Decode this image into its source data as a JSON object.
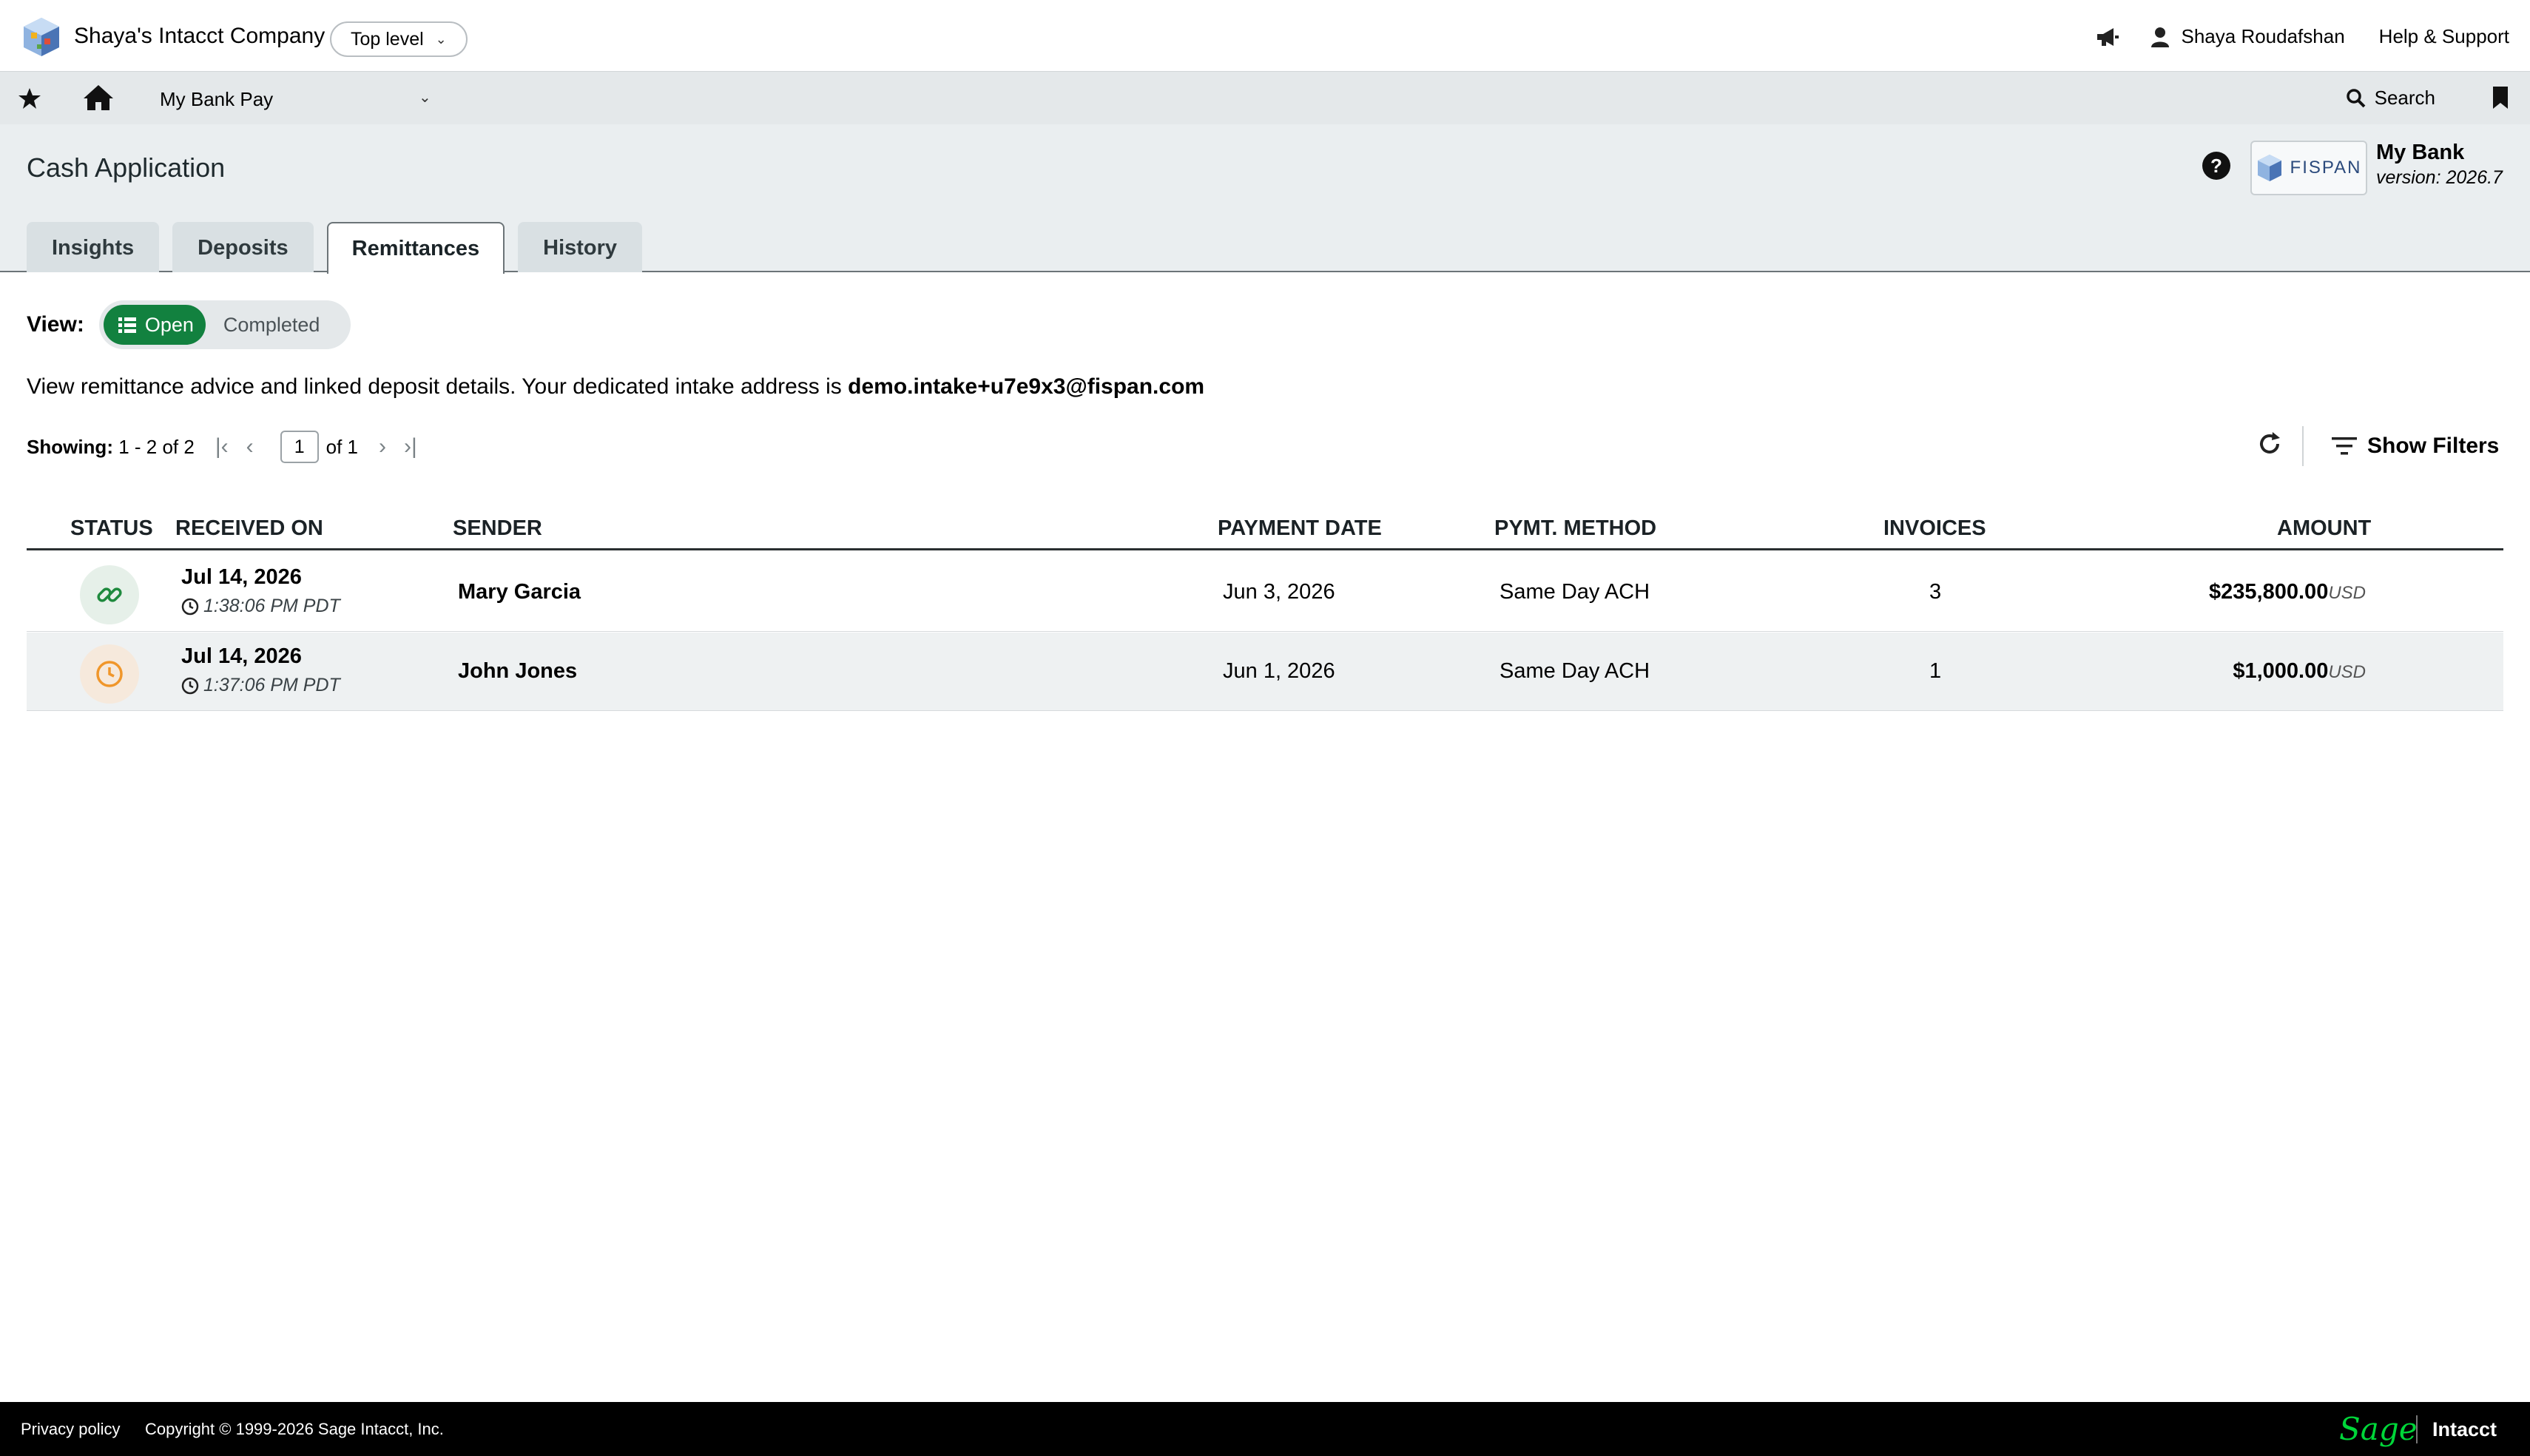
{
  "topbar": {
    "company": "Shaya's Intacct Company",
    "level": "Top level",
    "user_name": "Shaya Roudafshan",
    "help_support": "Help & Support"
  },
  "navbar": {
    "app_name": "My Bank Pay",
    "search_label": "Search"
  },
  "header": {
    "title": "Cash Application",
    "vendor_logo_text": "FISPAN",
    "bank_name": "My Bank",
    "bank_version": "version: 2026.7",
    "tabs": [
      {
        "label": "Insights"
      },
      {
        "label": "Deposits"
      },
      {
        "label": "Remittances",
        "active": true
      },
      {
        "label": "History"
      }
    ]
  },
  "view": {
    "label": "View:",
    "options": [
      "Open",
      "Completed"
    ],
    "selected": "Open"
  },
  "description": {
    "text": "View remittance advice and linked deposit details. Your dedicated intake address is ",
    "email": "demo.intake+u7e9x3@fispan.com"
  },
  "pager": {
    "showing_label": "Showing:",
    "range": "1 - 2 of 2",
    "page": "1",
    "of_pages": "of 1"
  },
  "toolbar": {
    "filters_label": "Show Filters"
  },
  "table": {
    "columns": [
      "STATUS",
      "RECEIVED ON",
      "SENDER",
      "PAYMENT DATE",
      "PYMT. METHOD",
      "INVOICES",
      "AMOUNT"
    ],
    "rows": [
      {
        "status_icon": "link-icon",
        "received_date": "Jul 14, 2026",
        "received_time": "1:38:06 PM PDT",
        "sender": "Mary Garcia",
        "payment_date": "Jun 3, 2026",
        "method": "Same Day ACH",
        "invoices": "3",
        "amount": "$235,800.00",
        "currency": "USD"
      },
      {
        "status_icon": "clock-icon",
        "received_date": "Jul 14, 2026",
        "received_time": "1:37:06 PM PDT",
        "sender": "John Jones",
        "payment_date": "Jun 1, 2026",
        "method": "Same Day ACH",
        "invoices": "1",
        "amount": "$1,000.00",
        "currency": "USD"
      }
    ]
  },
  "footer": {
    "privacy": "Privacy policy",
    "copyright": "Copyright © 1999-2026 Sage Intacct, Inc.",
    "brand_sage": "Sage",
    "brand_intacct": "Intacct"
  },
  "colors": {
    "accent_green": "#12813f",
    "status_link_green": "#1f8a3e",
    "status_pending_orange": "#f0962a",
    "footer_bg": "#000000"
  }
}
